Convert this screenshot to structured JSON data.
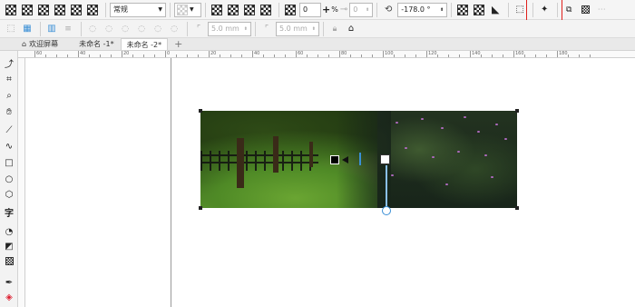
{
  "toolbar": {
    "merge_mode": "常规",
    "opacity_value": "0",
    "percent_sign": "%",
    "feather_value": "0",
    "angle_value": "-178.0 °"
  },
  "toolbar2": {
    "distance1": "5.0 mm",
    "distance2": "5.0 mm"
  },
  "tabs": [
    {
      "label": "欢迎屏幕"
    },
    {
      "label": "未命名 -1*"
    },
    {
      "label": "未命名 -2*"
    }
  ],
  "ruler": {
    "top_labels": [
      "60",
      "40",
      "20",
      "0",
      "20",
      "40",
      "60",
      "80",
      "100",
      "120",
      "140",
      "160",
      "180"
    ]
  },
  "left_tools": [
    "pick-tool",
    "shape-tool",
    "crop-tool",
    "zoom-tool",
    "pan-tool",
    "freehand-tool",
    "artistic-media-tool",
    "rectangle-tool",
    "ellipse-tool",
    "polygon-tool",
    "text-tool",
    "shadow-tool",
    "transparency-tool",
    "eyedropper-tool",
    "fill-tool"
  ],
  "colors": {
    "highlight": "#e0201c",
    "handle_blue": "#3a8fd6"
  }
}
